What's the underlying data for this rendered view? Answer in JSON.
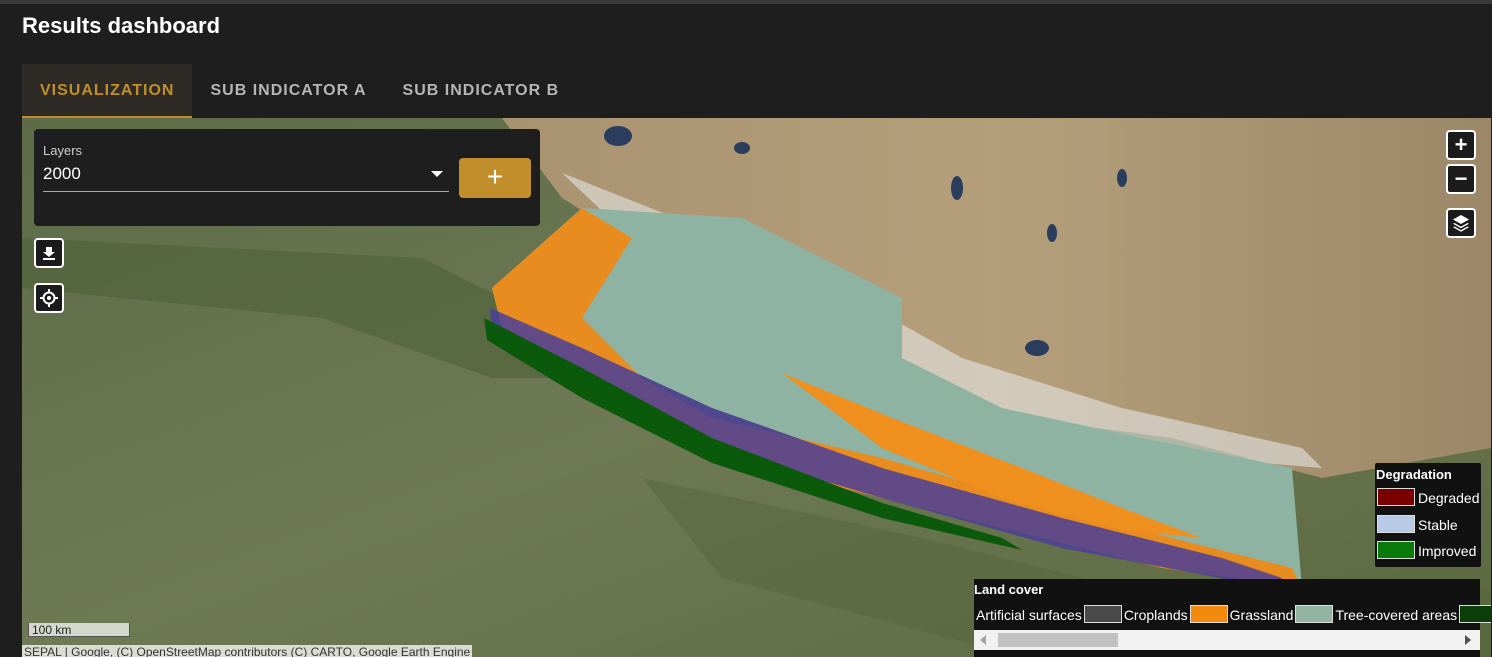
{
  "page": {
    "title": "Results dashboard"
  },
  "tabs": [
    {
      "label": "VISUALIZATION",
      "active": true
    },
    {
      "label": "SUB INDICATOR A",
      "active": false
    },
    {
      "label": "SUB INDICATOR B",
      "active": false
    }
  ],
  "layers": {
    "label": "Layers",
    "selected": "2000",
    "add_label": "+"
  },
  "map_controls": {
    "zoom_in": "+",
    "zoom_out": "−",
    "icons": [
      "download-icon",
      "crosshair-icon",
      "layers-icon"
    ]
  },
  "legend_degradation": {
    "title": "Degradation",
    "items": [
      {
        "label": "Degraded",
        "color": "#7a0000"
      },
      {
        "label": "Stable",
        "color": "#b8cbe6"
      },
      {
        "label": "Improved",
        "color": "#0a7a0a"
      }
    ]
  },
  "legend_land_cover": {
    "title": "Land cover",
    "items": [
      {
        "label": "Artificial surfaces",
        "color": "#4a4a4a"
      },
      {
        "label": "Croplands",
        "color": "#f28a0e"
      },
      {
        "label": "Grassland",
        "color": "#93b4a3"
      },
      {
        "label": "Tree-covered areas",
        "color": "#0b3d0b"
      }
    ]
  },
  "scale_bar": "100 km",
  "attribution": "SEPAL | Google, (C) OpenStreetMap contributors (C) CARTO, Google Earth Engine",
  "colors": {
    "accent": "#c08f2c",
    "background": "#1e1e1e"
  }
}
